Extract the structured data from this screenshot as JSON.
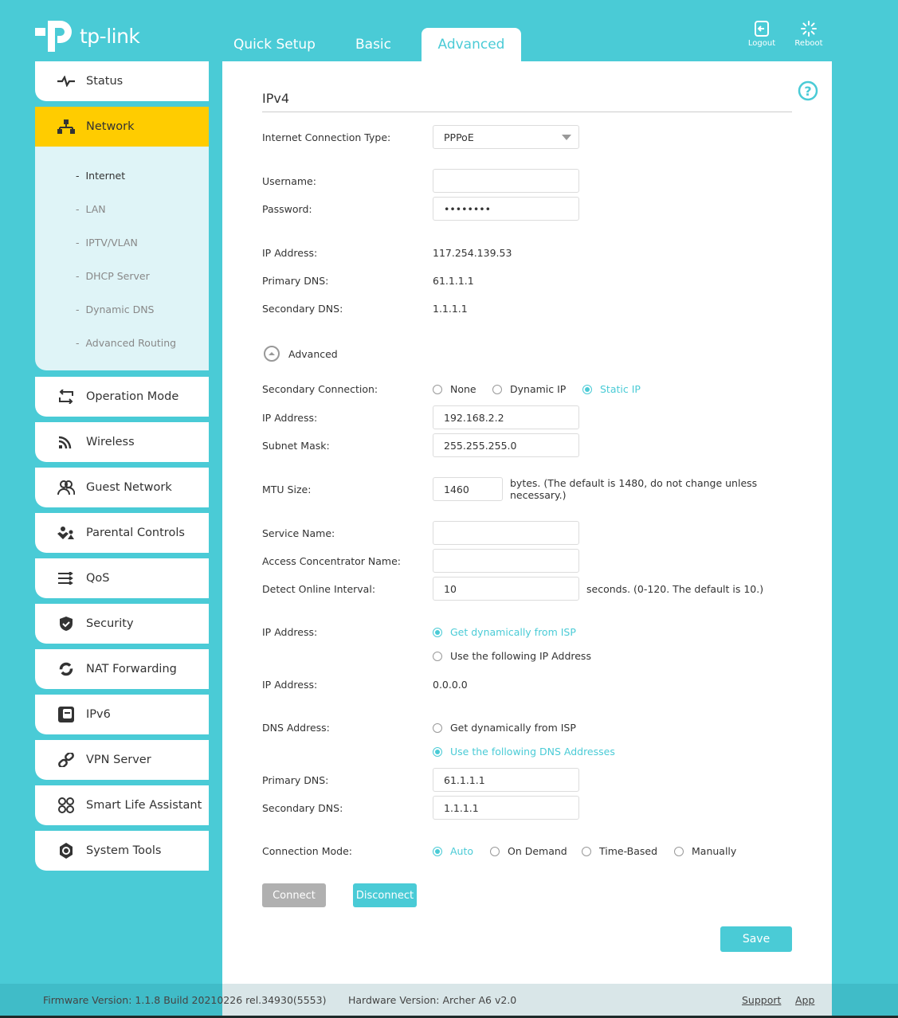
{
  "brand": {
    "name": "tp-link"
  },
  "nav": {
    "tabs": [
      {
        "label": "Quick Setup"
      },
      {
        "label": "Basic"
      },
      {
        "label": "Advanced",
        "active": true
      }
    ],
    "logout": "Logout",
    "reboot": "Reboot"
  },
  "sidebar": {
    "items": [
      {
        "label": "Status",
        "icon": "pulse-icon"
      },
      {
        "label": "Network",
        "icon": "network-icon",
        "active": true,
        "sub": [
          "Internet",
          "LAN",
          "IPTV/VLAN",
          "DHCP Server",
          "Dynamic DNS",
          "Advanced Routing"
        ]
      },
      {
        "label": "Operation Mode",
        "icon": "swap-icon"
      },
      {
        "label": "Wireless",
        "icon": "wifi-icon"
      },
      {
        "label": "Guest Network",
        "icon": "users-icon"
      },
      {
        "label": "Parental Controls",
        "icon": "family-icon"
      },
      {
        "label": "QoS",
        "icon": "qos-icon"
      },
      {
        "label": "Security",
        "icon": "shield-icon"
      },
      {
        "label": "NAT Forwarding",
        "icon": "refresh-icon"
      },
      {
        "label": "IPv6",
        "icon": "ipv6-icon"
      },
      {
        "label": "VPN Server",
        "icon": "link-icon"
      },
      {
        "label": "Smart Life Assistant",
        "icon": "command-icon"
      },
      {
        "label": "System Tools",
        "icon": "gear-icon"
      }
    ]
  },
  "form": {
    "section": "IPv4",
    "conn_type_label": "Internet Connection Type:",
    "conn_type": "PPPoE",
    "username_label": "Username:",
    "username": "",
    "password_label": "Password:",
    "password": "••••••••",
    "ip_label": "IP Address:",
    "ip": "117.254.139.53",
    "pdns_label": "Primary DNS:",
    "pdns": "61.1.1.1",
    "sdns_label": "Secondary DNS:",
    "sdns": "1.1.1.1",
    "advanced_toggle": "Advanced",
    "secondary_label": "Secondary Connection:",
    "secondary_options": [
      "None",
      "Dynamic IP",
      "Static IP"
    ],
    "secondary_selected": "Static IP",
    "sec_ip_label": "IP Address:",
    "sec_ip": "192.168.2.2",
    "mask_label": "Subnet Mask:",
    "mask": "255.255.255.0",
    "mtu_label": "MTU Size:",
    "mtu": "1460",
    "mtu_hint": "bytes. (The default is 1480, do not change unless necessary.)",
    "service_label": "Service Name:",
    "service": "",
    "ac_label": "Access Concentrator Name:",
    "ac": "",
    "detect_label": "Detect Online Interval:",
    "detect": "10",
    "detect_hint": "seconds. (0-120. The default is 10.)",
    "ipmode_label": "IP Address:",
    "ipmode_options": [
      "Get dynamically from ISP",
      "Use the following IP Address"
    ],
    "ipmode_selected": "Get dynamically from ISP",
    "ip2_label": "IP Address:",
    "ip2": "0.0.0.0",
    "dnsmode_label": "DNS Address:",
    "dnsmode_options": [
      "Get dynamically from ISP",
      "Use the following DNS Addresses"
    ],
    "dnsmode_selected": "Use the following DNS Addresses",
    "pdns2_label": "Primary DNS:",
    "pdns2": "61.1.1.1",
    "sdns2_label": "Secondary DNS:",
    "sdns2": "1.1.1.1",
    "connmode_label": "Connection Mode:",
    "connmode_options": [
      "Auto",
      "On Demand",
      "Time-Based",
      "Manually"
    ],
    "connmode_selected": "Auto",
    "connect": "Connect",
    "disconnect": "Disconnect",
    "save": "Save"
  },
  "footer": {
    "firmware": "Firmware Version: 1.1.8 Build 20210226 rel.34930(5553)",
    "hardware": "Hardware Version: Archer A6 v2.0",
    "support": "Support",
    "app": "App"
  },
  "colors": {
    "accent": "#4acbd6",
    "active_nav": "#ffcc00",
    "disabled_button": "#b0b0b0"
  }
}
